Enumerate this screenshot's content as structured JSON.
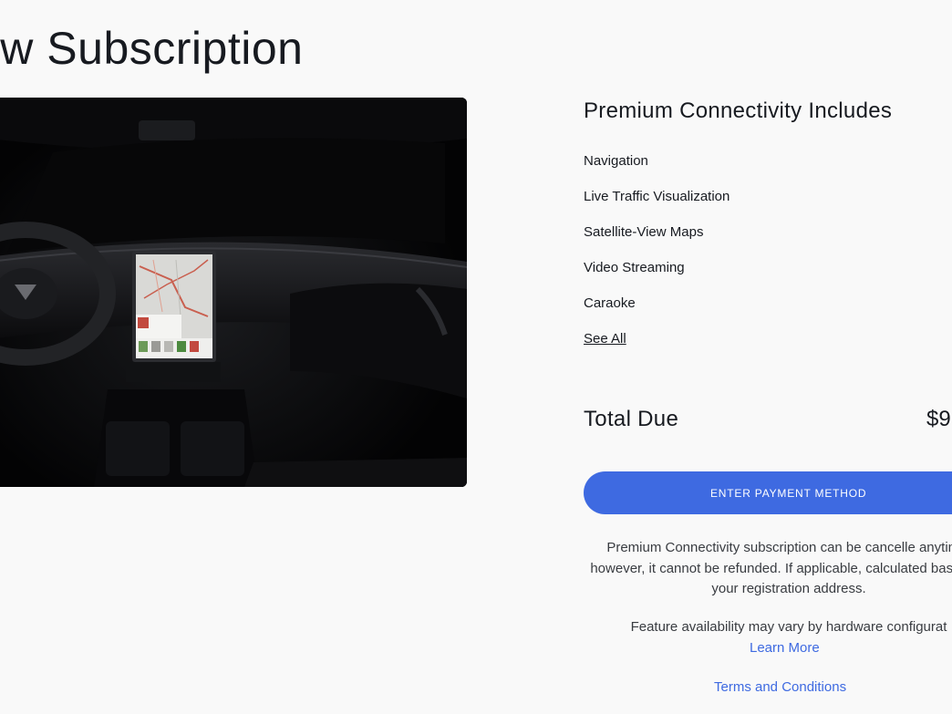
{
  "page": {
    "title": "ew Subscription"
  },
  "features": {
    "heading": "Premium Connectivity Includes",
    "items": [
      "Navigation",
      "Live Traffic Visualization",
      "Satellite-View Maps",
      "Video Streaming",
      "Caraoke"
    ],
    "see_all": "See All"
  },
  "total": {
    "label": "Total Due",
    "value": "$9"
  },
  "payment": {
    "button_label": "ENTER PAYMENT METHOD"
  },
  "notes": {
    "cancellation": "Premium Connectivity subscription can be cancelle anytime; however, it cannot be refunded. If applicable, calculated based on your registration address.",
    "availability": "Feature availability may vary by hardware configurat",
    "learn_more": "Learn More",
    "terms": "Terms and Conditions"
  },
  "colors": {
    "accent": "#3e6ae1",
    "background": "#f9f9f9",
    "text": "#171a20"
  }
}
